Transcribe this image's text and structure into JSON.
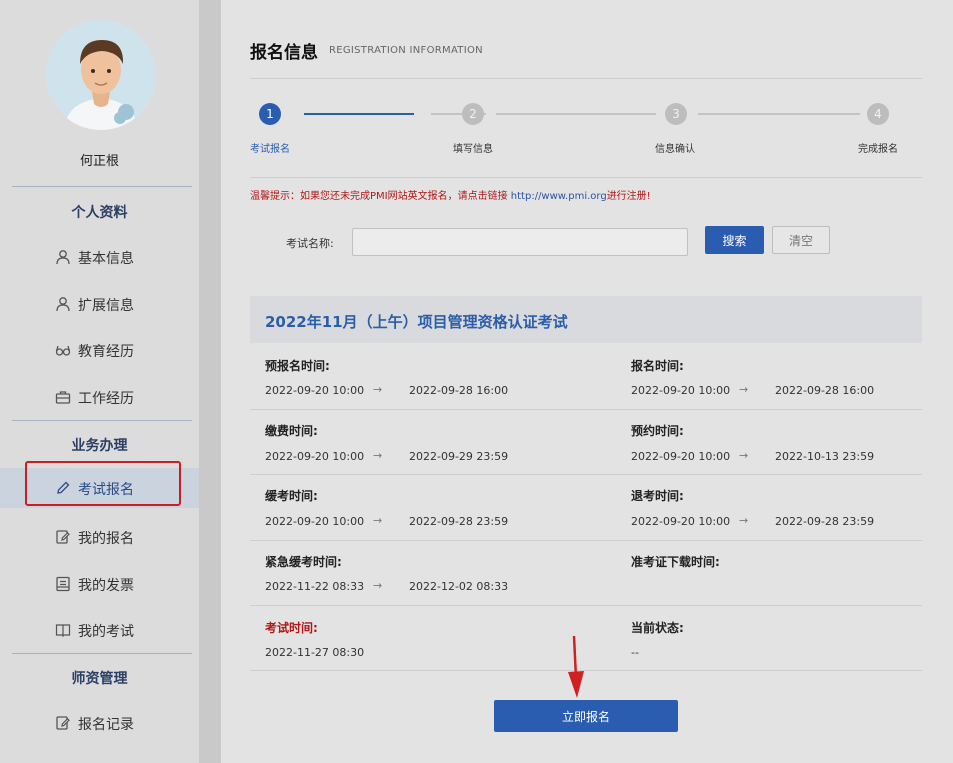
{
  "sidebar": {
    "user_name": "何正根",
    "section_profile": "个人资料",
    "section_business": "业务办理",
    "section_credential": "师资管理",
    "items": [
      {
        "label": "基本信息",
        "icon": "user-icon"
      },
      {
        "label": "扩展信息",
        "icon": "user-icon"
      },
      {
        "label": "教育经历",
        "icon": "glasses-icon"
      },
      {
        "label": "工作经历",
        "icon": "briefcase-icon"
      },
      {
        "label": "考试报名",
        "icon": "pencil-icon",
        "active": true
      },
      {
        "label": "我的报名",
        "icon": "edit-doc-icon"
      },
      {
        "label": "我的发票",
        "icon": "invoice-icon"
      },
      {
        "label": "我的考试",
        "icon": "book-icon"
      },
      {
        "label": "报名记录",
        "icon": "edit-doc-icon"
      }
    ]
  },
  "header": {
    "title": "报名信息",
    "subtitle": "REGISTRATION INFORMATION"
  },
  "steps": [
    {
      "num": "1",
      "label": "考试报名",
      "active": true
    },
    {
      "num": "2",
      "label": "填写信息",
      "active": false
    },
    {
      "num": "3",
      "label": "信息确认",
      "active": false
    },
    {
      "num": "4",
      "label": "完成报名",
      "active": false
    }
  ],
  "warning": {
    "text": "温馨提示：如果您还未完成PMI网站英文报名，请点击链接 ",
    "link": "http://www.pmi.org",
    "suffix": "进行注册!"
  },
  "search": {
    "label": "考试名称:",
    "value": "",
    "search_button": "搜索",
    "clear_button": "清空"
  },
  "exam": {
    "title": "2022年11月（上午）项目管理资格认证考试",
    "arrow": "→",
    "fields": {
      "pre_reg": {
        "label": "预报名时间:",
        "start": "2022-09-20 10:00",
        "end": "2022-09-28 16:00"
      },
      "reg": {
        "label": "报名时间:",
        "start": "2022-09-20 10:00",
        "end": "2022-09-28 16:00"
      },
      "pay": {
        "label": "缴费时间:",
        "start": "2022-09-20 10:00",
        "end": "2022-09-29 23:59"
      },
      "appoint": {
        "label": "预约时间:",
        "start": "2022-09-20 10:00",
        "end": "2022-10-13 23:59"
      },
      "defer": {
        "label": "缓考时间:",
        "start": "2022-09-20 10:00",
        "end": "2022-09-28 23:59"
      },
      "withdraw": {
        "label": "退考时间:",
        "start": "2022-09-20 10:00",
        "end": "2022-09-28 23:59"
      },
      "urgent": {
        "label": "紧急缓考时间:",
        "start": "2022-11-22 08:33",
        "end": "2022-12-02 08:33"
      },
      "ticket": {
        "label": "准考证下载时间:"
      },
      "exam_time": {
        "label": "考试时间:",
        "value": "2022-11-27 08:30"
      },
      "status": {
        "label": "当前状态:",
        "value": "--"
      }
    },
    "register_button": "立即报名"
  }
}
